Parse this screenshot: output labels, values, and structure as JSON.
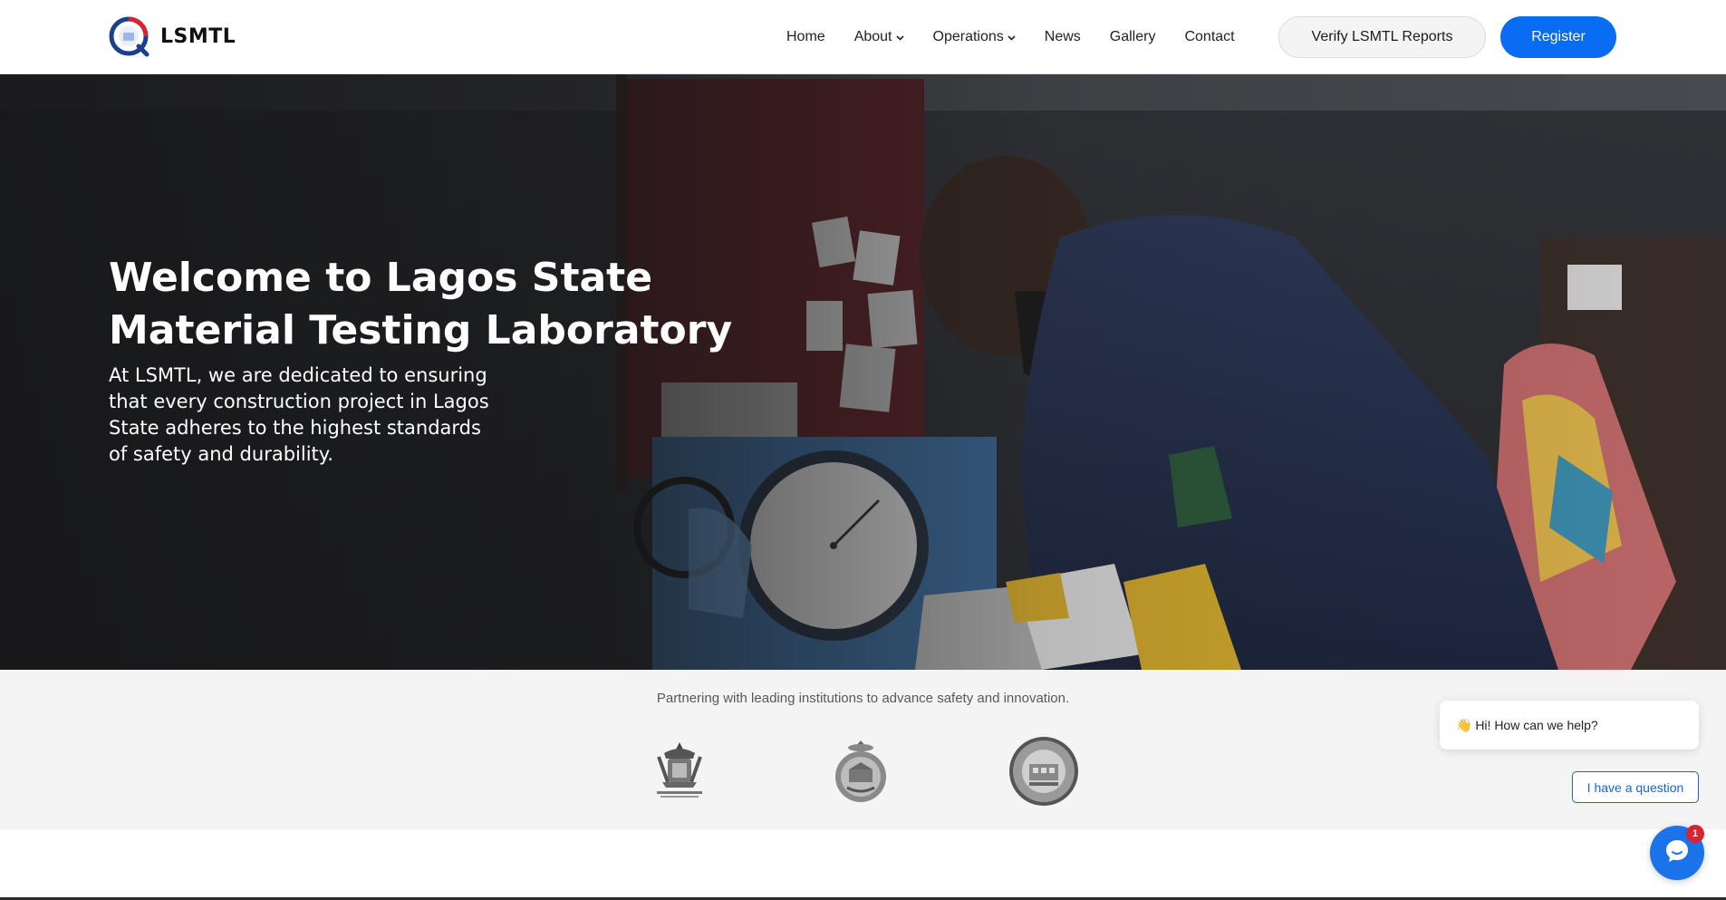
{
  "brand": {
    "name": "LSMTL"
  },
  "nav": {
    "items": [
      {
        "label": "Home",
        "dropdown": false
      },
      {
        "label": "About",
        "dropdown": true
      },
      {
        "label": "Operations",
        "dropdown": true
      },
      {
        "label": "News",
        "dropdown": false
      },
      {
        "label": "Gallery",
        "dropdown": false
      },
      {
        "label": "Contact",
        "dropdown": false
      }
    ],
    "verify_label": "Verify LSMTL Reports",
    "register_label": "Register"
  },
  "hero": {
    "title": "Welcome to Lagos State Material Testing Laboratory",
    "subtitle": "At LSMTL, we are dedicated to ensuring that every construction project in Lagos State adheres to the highest standards of safety and durability."
  },
  "partners": {
    "text": "Partnering with leading institutions to advance safety and innovation.",
    "logos": [
      "lagos-state-government-logo",
      "ministry-seal-logo",
      "building-control-agency-seal-logo"
    ]
  },
  "chat": {
    "greeting": "👋 Hi! How can we help?",
    "question_label": "I have a question",
    "badge_count": "1"
  },
  "colors": {
    "primary": "#0a6cf3",
    "chat_blue": "#1a73e8",
    "badge_red": "#d9232d",
    "partners_bg": "#f4f4f4"
  }
}
